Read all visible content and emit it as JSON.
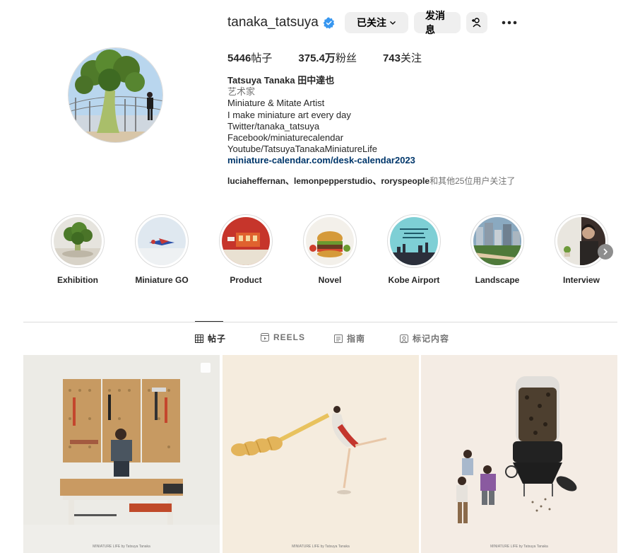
{
  "profile": {
    "username": "tanaka_tatsuya",
    "verified": true,
    "follow_label": "已关注",
    "message_label": "发消息",
    "stats": {
      "posts_count": "5446",
      "posts_label": "帖子",
      "followers_count": "375.4万",
      "followers_label": "粉丝",
      "following_count": "743",
      "following_label": "关注"
    },
    "bio": {
      "name": "Tatsuya Tanaka 田中達也",
      "category": "艺术家",
      "lines": [
        "Miniature & Mitate Artist",
        "I make miniature art every day",
        "Twitter/tanaka_tatsuya",
        "Facebook/miniaturecalendar",
        "Youtube/TatsuyaTanakaMiniatureLife"
      ],
      "link": "miniature-calendar.com/desk-calendar2023"
    },
    "followed_by": {
      "users": "luciaheffernan、lemonpepperstudio、roryspeople",
      "suffix": "和其他25位用户关注了"
    }
  },
  "highlights": [
    {
      "label": "Exhibition"
    },
    {
      "label": "Miniature GO"
    },
    {
      "label": "Product"
    },
    {
      "label": "Novel"
    },
    {
      "label": "Kobe Airport"
    },
    {
      "label": "Landscape"
    },
    {
      "label": "Interview"
    }
  ],
  "tabs": [
    {
      "label": "帖子",
      "active": true
    },
    {
      "label": "REELS",
      "active": false
    },
    {
      "label": "指南",
      "active": false
    },
    {
      "label": "标记内容",
      "active": false
    }
  ],
  "colors": {
    "accent_verified": "#3897f0",
    "link": "#00376b",
    "button_bg": "#efefef"
  }
}
